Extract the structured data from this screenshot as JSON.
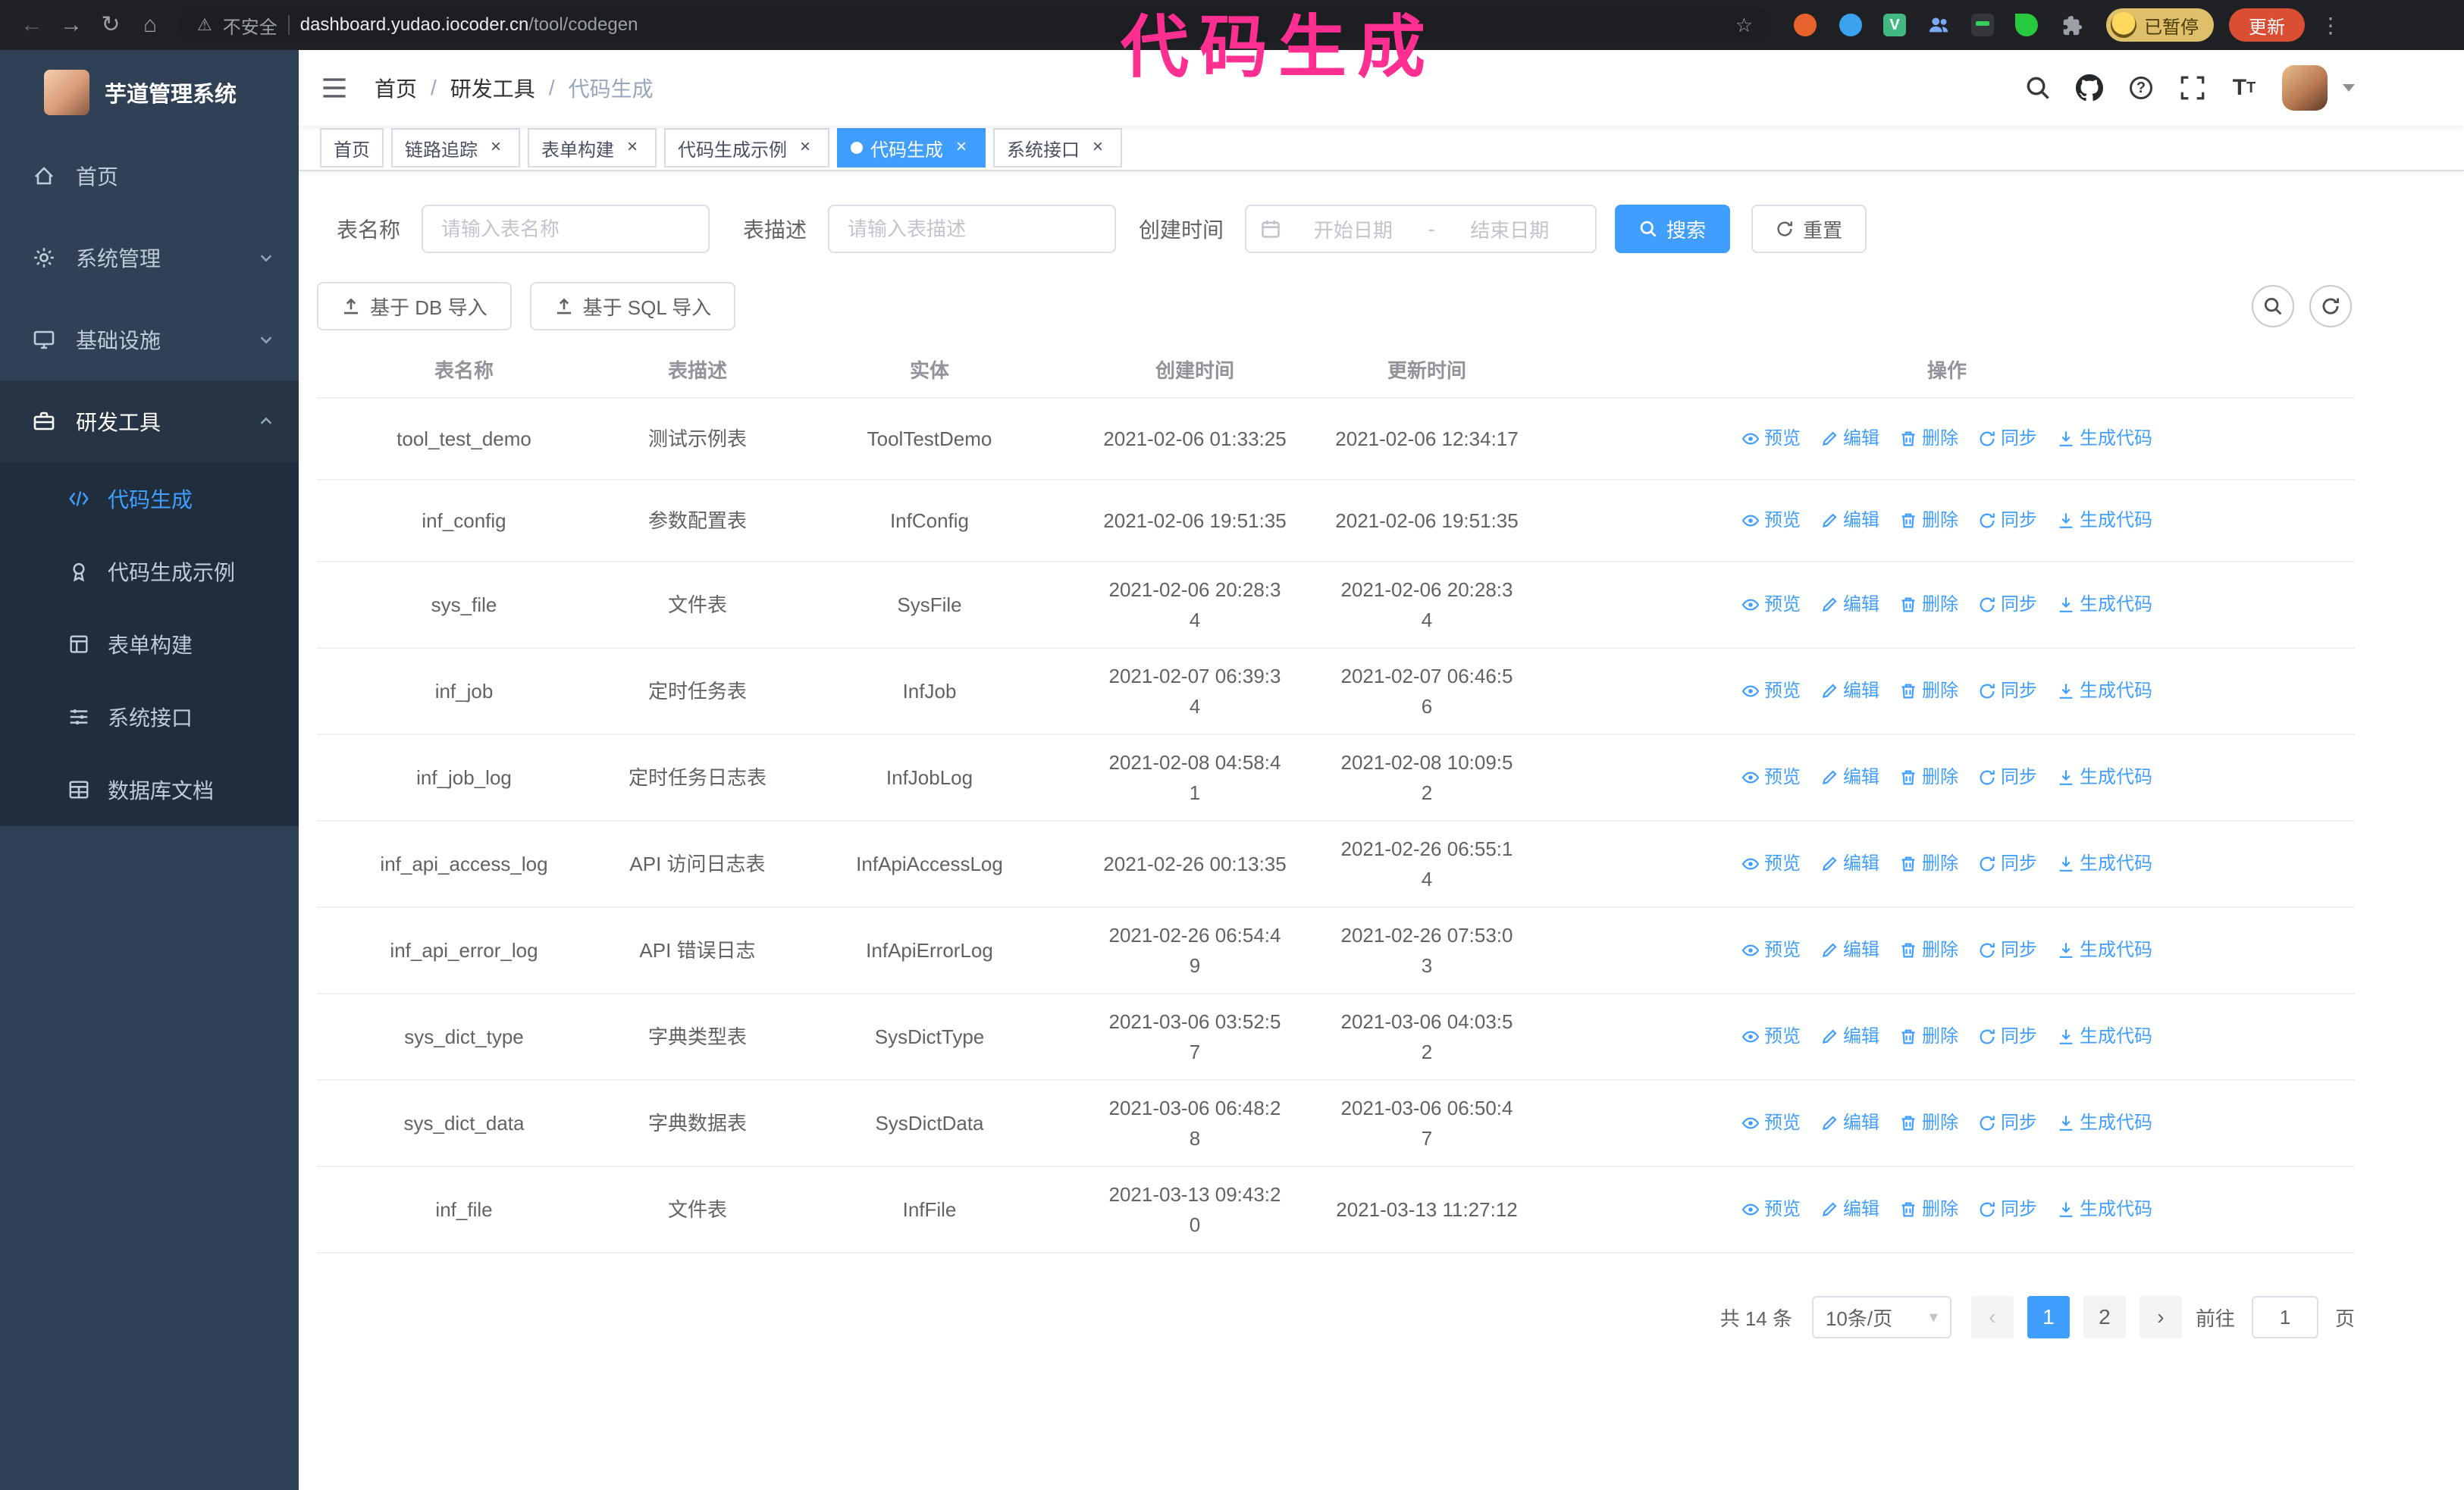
{
  "annotation": {
    "text": "代码生成",
    "color": "#ff2f92"
  },
  "browser": {
    "security_label": "不安全",
    "url_host": "dashboard.yudao.iocoder.cn",
    "url_path": "/tool/codegen",
    "profile_badge": "已暂停",
    "update_button": "更新",
    "nav_icons": [
      "back-icon",
      "forward-icon",
      "reload-icon",
      "home-icon"
    ],
    "extension_icons": [
      "extension-orange-icon",
      "extension-drop-icon",
      "extension-vue-icon",
      "extension-people-icon",
      "extension-screen-icon",
      "extension-leaf-icon",
      "extensions-puzzle-icon"
    ]
  },
  "sidebar": {
    "logo_title": "芋道管理系统",
    "items": [
      {
        "label": "首页",
        "icon": "home-icon"
      },
      {
        "label": "系统管理",
        "icon": "gear-icon"
      },
      {
        "label": "基础设施",
        "icon": "infrastructure-icon"
      },
      {
        "label": "研发工具",
        "icon": "dev-tools-icon",
        "expanded": true
      }
    ],
    "subitems": [
      {
        "label": "代码生成",
        "icon": "code-icon",
        "active": true
      },
      {
        "label": "代码生成示例",
        "icon": "example-icon"
      },
      {
        "label": "表单构建",
        "icon": "form-builder-icon"
      },
      {
        "label": "系统接口",
        "icon": "api-icon"
      },
      {
        "label": "数据库文档",
        "icon": "database-doc-icon"
      }
    ]
  },
  "header": {
    "breadcrumb": [
      "首页",
      "研发工具",
      "代码生成"
    ]
  },
  "tabs": [
    {
      "label": "首页",
      "closable": false,
      "active": false
    },
    {
      "label": "链路追踪",
      "closable": true,
      "active": false
    },
    {
      "label": "表单构建",
      "closable": true,
      "active": false
    },
    {
      "label": "代码生成示例",
      "closable": true,
      "active": false
    },
    {
      "label": "代码生成",
      "closable": true,
      "active": true
    },
    {
      "label": "系统接口",
      "closable": true,
      "active": false
    }
  ],
  "filters": {
    "name_label": "表名称",
    "name_placeholder": "请输入表名称",
    "desc_label": "表描述",
    "desc_placeholder": "请输入表描述",
    "time_label": "创建时间",
    "start_placeholder": "开始日期",
    "range_separator": "-",
    "end_placeholder": "结束日期",
    "search_button": "搜索",
    "reset_button": "重置"
  },
  "toolbar": {
    "db_import": "基于 DB 导入",
    "sql_import": "基于 SQL 导入"
  },
  "table": {
    "columns": [
      "表名称",
      "表描述",
      "实体",
      "创建时间",
      "更新时间",
      "操作"
    ],
    "ops": [
      {
        "label": "预览",
        "icon": "preview-eye-icon"
      },
      {
        "label": "编辑",
        "icon": "edit-icon"
      },
      {
        "label": "删除",
        "icon": "delete-icon"
      },
      {
        "label": "同步",
        "icon": "sync-icon"
      },
      {
        "label": "生成代码",
        "icon": "generate-code-icon"
      }
    ],
    "rows": [
      {
        "name": "tool_test_demo",
        "desc": "测试示例表",
        "entity": "ToolTestDemo",
        "created": "2021-02-06 01:33:25",
        "updated": "2021-02-06 12:34:17"
      },
      {
        "name": "inf_config",
        "desc": "参数配置表",
        "entity": "InfConfig",
        "created": "2021-02-06 19:51:35",
        "updated": "2021-02-06 19:51:35"
      },
      {
        "name": "sys_file",
        "desc": "文件表",
        "entity": "SysFile",
        "created": "2021-02-06 20:28:3\n4",
        "updated": "2021-02-06 20:28:3\n4"
      },
      {
        "name": "inf_job",
        "desc": "定时任务表",
        "entity": "InfJob",
        "created": "2021-02-07 06:39:3\n4",
        "updated": "2021-02-07 06:46:5\n6"
      },
      {
        "name": "inf_job_log",
        "desc": "定时任务日志表",
        "entity": "InfJobLog",
        "created": "2021-02-08 04:58:4\n1",
        "updated": "2021-02-08 10:09:5\n2"
      },
      {
        "name": "inf_api_access_log",
        "desc": "API 访问日志表",
        "entity": "InfApiAccessLog",
        "created": "2021-02-26 00:13:35",
        "updated": "2021-02-26 06:55:1\n4"
      },
      {
        "name": "inf_api_error_log",
        "desc": "API 错误日志",
        "entity": "InfApiErrorLog",
        "created": "2021-02-26 06:54:4\n9",
        "updated": "2021-02-26 07:53:0\n3"
      },
      {
        "name": "sys_dict_type",
        "desc": "字典类型表",
        "entity": "SysDictType",
        "created": "2021-03-06 03:52:5\n7",
        "updated": "2021-03-06 04:03:5\n2"
      },
      {
        "name": "sys_dict_data",
        "desc": "字典数据表",
        "entity": "SysDictData",
        "created": "2021-03-06 06:48:2\n8",
        "updated": "2021-03-06 06:50:4\n7"
      },
      {
        "name": "inf_file",
        "desc": "文件表",
        "entity": "InfFile",
        "created": "2021-03-13 09:43:2\n0",
        "updated": "2021-03-13 11:27:12"
      }
    ]
  },
  "pagination": {
    "total": "共 14 条",
    "page_size": "10条/页",
    "pages": [
      "1",
      "2"
    ],
    "active_page": "1",
    "goto_label": "前往",
    "goto_value": "1",
    "goto_unit": "页"
  },
  "colors": {
    "primary": "#409eff",
    "sidebar_bg": "#304156",
    "submenu_bg": "#1f2d3d",
    "annotation": "#ff2f92",
    "update_button": "#da4f33"
  }
}
